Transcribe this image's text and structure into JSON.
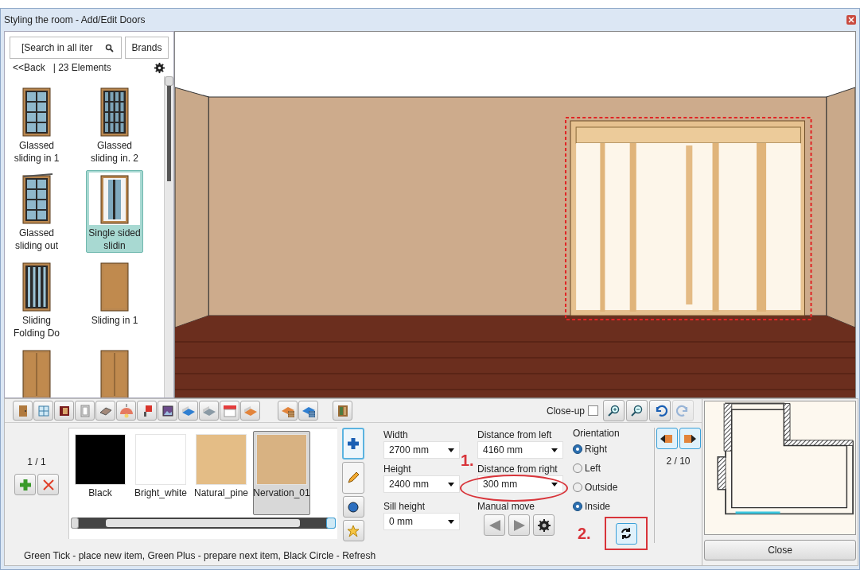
{
  "window": {
    "title": "Styling the room - Add/Edit Doors"
  },
  "catalog": {
    "search": {
      "placeholder": "[Search in all iter"
    },
    "brands_button": "Brands",
    "back_link": "<<Back",
    "count": "| 23 Elements",
    "items": [
      {
        "label": "Glassed sliding in 1",
        "kind": "glass-grid",
        "selected": false
      },
      {
        "label": "Glassed sliding in. 2",
        "kind": "glass-dark",
        "selected": false
      },
      {
        "label": "Glassed sliding out",
        "kind": "glass-out",
        "selected": false
      },
      {
        "label": "Single sided slidin",
        "kind": "single-sliding",
        "selected": true
      },
      {
        "label": "Sliding Folding Do",
        "kind": "folding",
        "selected": false
      },
      {
        "label": "Sliding in 1",
        "kind": "panel",
        "selected": false
      },
      {
        "kind": "double-panel",
        "selected": false
      },
      {
        "kind": "double-panel",
        "selected": false
      }
    ]
  },
  "toolbar": {
    "closeup": {
      "label": "Close-up",
      "checked": false
    },
    "redo_disabled": true
  },
  "materials": {
    "page": "1 / 1",
    "items": [
      {
        "name": "Black",
        "color": "#000000",
        "selected": false
      },
      {
        "name": "Bright_white",
        "color": "#ffffff",
        "selected": false
      },
      {
        "name": "Natural_pine",
        "color": "#e4bd86",
        "selected": false
      },
      {
        "name": "Nervation_01",
        "color": "#d8b282",
        "selected": true
      }
    ]
  },
  "fields": [
    {
      "label": "Width",
      "value": "2700 mm",
      "highlighted": false
    },
    {
      "label": "Distance from left",
      "value": "4160 mm",
      "highlighted": false
    },
    {
      "label": "Height",
      "value": "2400 mm",
      "highlighted": false
    },
    {
      "label": "Distance from right",
      "value": "300 mm",
      "highlighted": true
    },
    {
      "label": "Sill height",
      "value": "0 mm",
      "highlighted": false
    }
  ],
  "manual_move": {
    "label": "Manual move"
  },
  "orientation": {
    "label": "Orientation",
    "options": [
      {
        "label": "Right",
        "selected": true
      },
      {
        "label": "Left",
        "selected": false
      },
      {
        "label": "Outside",
        "selected": false
      },
      {
        "label": "Inside",
        "selected": true
      }
    ]
  },
  "annotations": [
    "1.",
    "2."
  ],
  "refresh_highlighted": true,
  "wall_nav": {
    "page": "2 / 10"
  },
  "close_button": "Close",
  "status_bar": "Green Tick - place new item, Green Plus - prepare next item, Black Circle - Refresh"
}
